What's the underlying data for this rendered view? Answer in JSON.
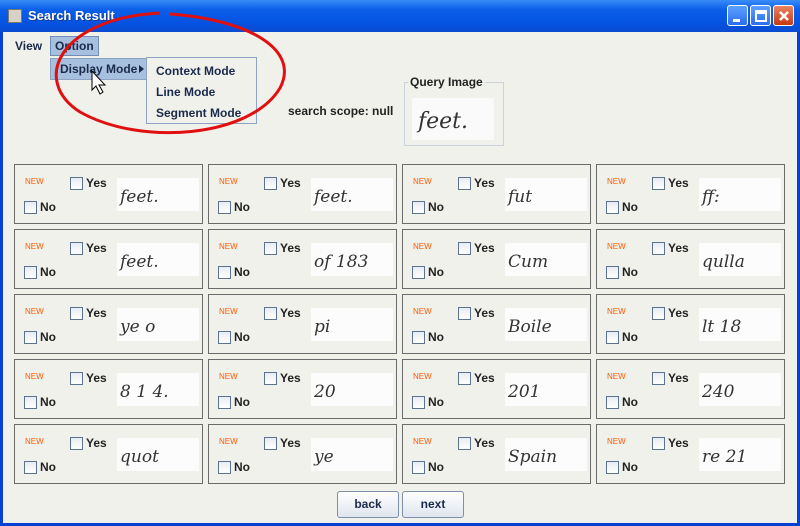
{
  "window": {
    "title": "Search Result"
  },
  "menu": {
    "view": "View",
    "option": "Option"
  },
  "dropdown": {
    "display_mode": "Display Mode"
  },
  "submenu": {
    "items": [
      "Context Mode",
      "Line Mode",
      "Segment Mode"
    ]
  },
  "scope": {
    "label": "search scope: null"
  },
  "query": {
    "label": "Query Image",
    "word": "feet."
  },
  "labels": {
    "new": "NEW",
    "yes": "Yes",
    "no": "No"
  },
  "results": [
    {
      "word": "feet."
    },
    {
      "word": "feet."
    },
    {
      "word": "fut"
    },
    {
      "word": "ff:"
    },
    {
      "word": "feet."
    },
    {
      "word": "of 183"
    },
    {
      "word": "Cum"
    },
    {
      "word": "qulla"
    },
    {
      "word": "ye o"
    },
    {
      "word": "pi"
    },
    {
      "word": "Boile"
    },
    {
      "word": "lt 18"
    },
    {
      "word": "8 1 4."
    },
    {
      "word": "20"
    },
    {
      "word": "201"
    },
    {
      "word": "240"
    },
    {
      "word": "quot"
    },
    {
      "word": "ye"
    },
    {
      "word": "Spain"
    },
    {
      "word": "re 21"
    }
  ],
  "nav": {
    "back": "back",
    "next": "next"
  },
  "colors": {
    "titlebar": "#0553e2",
    "new_tag": "#ff5a00",
    "annotation": "#e01010",
    "menu_highlight": "#a8c0e0"
  }
}
